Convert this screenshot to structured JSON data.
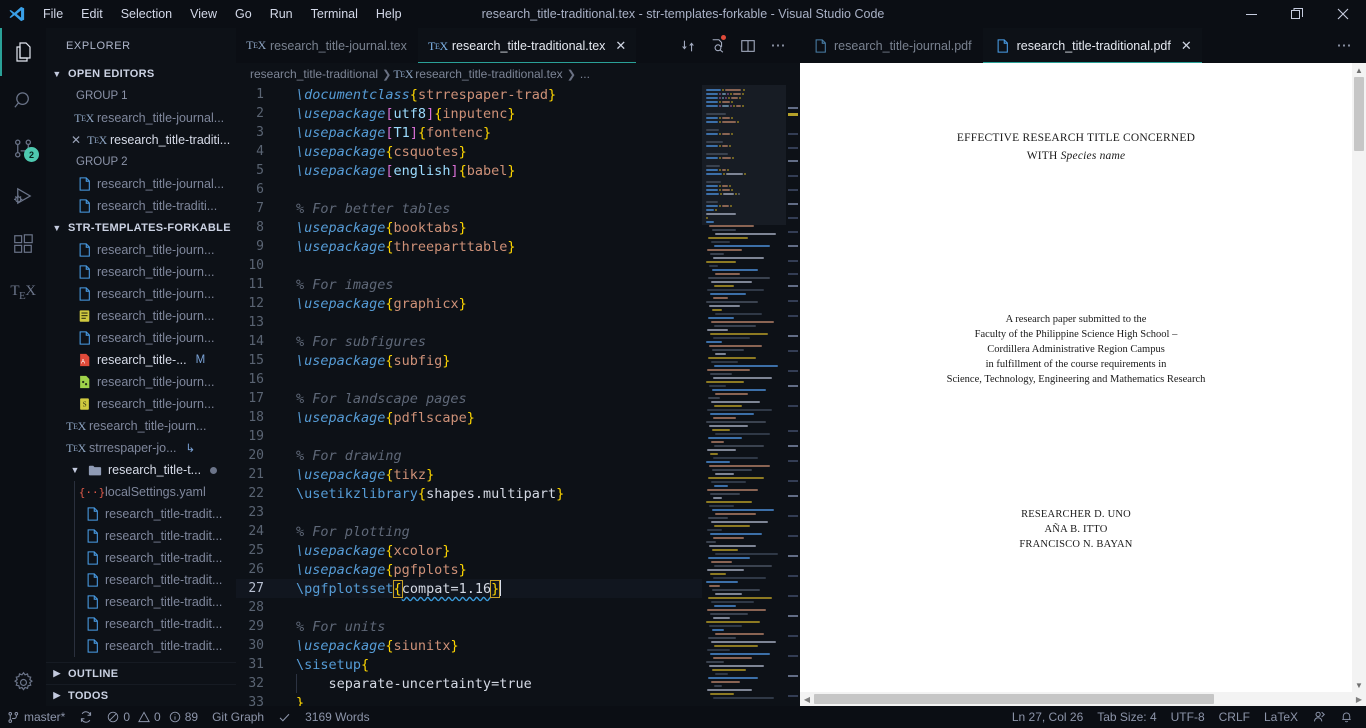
{
  "window": {
    "title": "research_title-traditional.tex - str-templates-forkable - Visual Studio Code",
    "minimize": "minimize-icon",
    "restore": "restore-icon",
    "close": "close-icon"
  },
  "menubar": {
    "items": [
      "File",
      "Edit",
      "Selection",
      "View",
      "Go",
      "Run",
      "Terminal",
      "Help"
    ]
  },
  "activitybar": {
    "items": [
      {
        "name": "explorer",
        "icon": "files-icon",
        "active": true,
        "badge": ""
      },
      {
        "name": "search",
        "icon": "search-icon",
        "active": false,
        "badge": ""
      },
      {
        "name": "source-control",
        "icon": "source-control-icon",
        "active": false,
        "badge": "2"
      },
      {
        "name": "run-and-debug",
        "icon": "run-debug-icon",
        "active": false,
        "badge": ""
      },
      {
        "name": "extensions",
        "icon": "extensions-icon",
        "active": false,
        "badge": ""
      },
      {
        "name": "latex",
        "icon": "tex-icon",
        "active": false,
        "badge": ""
      }
    ],
    "settings": {
      "name": "manage-settings",
      "icon": "gear-icon"
    }
  },
  "sidebar": {
    "title": "EXPLORER",
    "open_editors": {
      "label": "OPEN EDITORS",
      "groups": [
        {
          "label": "GROUP 1",
          "files": [
            {
              "icon": "tex-file-icon",
              "label": "research_title-journal...",
              "selected": false,
              "dirty": false,
              "close": ""
            },
            {
              "icon": "tex-file-icon",
              "label": "research_title-traditi...",
              "selected": true,
              "dirty": false,
              "close": "✕"
            }
          ]
        },
        {
          "label": "GROUP 2",
          "files": [
            {
              "icon": "pdf-blue-file-icon",
              "label": "research_title-journal...",
              "selected": false,
              "dirty": false,
              "close": ""
            },
            {
              "icon": "pdf-blue-file-icon",
              "label": "research_title-traditi...",
              "selected": false,
              "dirty": false,
              "close": ""
            }
          ]
        }
      ]
    },
    "workspace": {
      "label": "STR-TEMPLATES-FORKABLE",
      "files": [
        {
          "icon": "blue-file-icon",
          "label": "research_title-journ...",
          "suffix": ""
        },
        {
          "icon": "blue-file-icon",
          "label": "research_title-journ...",
          "suffix": ""
        },
        {
          "icon": "blue-file-icon",
          "label": "research_title-journ...",
          "suffix": ""
        },
        {
          "icon": "yellow-list-icon",
          "label": "research_title-journ...",
          "suffix": ""
        },
        {
          "icon": "blue-file-icon",
          "label": "research_title-journ...",
          "suffix": ""
        },
        {
          "icon": "pdf-red-icon",
          "label": "research_title-...",
          "suffix": "M",
          "modified": true
        },
        {
          "icon": "green-file-icon",
          "label": "research_title-journ...",
          "suffix": ""
        },
        {
          "icon": "yellow-bib-icon",
          "label": "research_title-journ...",
          "suffix": ""
        },
        {
          "icon": "tex-file-icon",
          "label": "research_title-journ...",
          "suffix": ""
        },
        {
          "icon": "tex-file-icon",
          "label": "strrespaper-jo...",
          "suffix": "↳"
        }
      ],
      "folder": {
        "icon": "folder-open-icon",
        "label": "research_title-t...",
        "dot": true,
        "children": [
          {
            "icon": "yaml-braces-icon",
            "label": "localSettings.yaml"
          },
          {
            "icon": "blue-file-icon",
            "label": "research_title-tradit..."
          },
          {
            "icon": "blue-file-icon",
            "label": "research_title-tradit..."
          },
          {
            "icon": "blue-file-icon",
            "label": "research_title-tradit..."
          },
          {
            "icon": "blue-file-icon",
            "label": "research_title-tradit..."
          },
          {
            "icon": "blue-file-icon",
            "label": "research_title-tradit..."
          },
          {
            "icon": "blue-file-icon",
            "label": "research_title-tradit..."
          },
          {
            "icon": "blue-file-icon",
            "label": "research_title-tradit..."
          }
        ]
      }
    },
    "outline": "OUTLINE",
    "todos": "TODOS"
  },
  "editor_group_1": {
    "tabs": [
      {
        "icon": "tex-file-icon",
        "label": "research_title-journal.tex",
        "active": false,
        "close": ""
      },
      {
        "icon": "tex-file-icon",
        "label": "research_title-traditional.tex",
        "active": true,
        "close": "✕"
      }
    ],
    "actions": [
      {
        "name": "build-latex-project",
        "icon": "sync-build-icon"
      },
      {
        "name": "view-latex-pdf",
        "icon": "pdf-search-icon"
      },
      {
        "name": "split-editor-right",
        "icon": "split-editor-icon"
      },
      {
        "name": "more-actions",
        "icon": "ellipsis-icon"
      }
    ],
    "breadcrumbs": [
      "research_title-traditional",
      "research_title-traditional.tex",
      "..."
    ],
    "breadcrumb_icon": "tex-file-icon",
    "active_line": 27,
    "code": [
      {
        "n": 1,
        "tokens": [
          {
            "t": "\\documentclass",
            "c": "cmd"
          },
          {
            "t": "{",
            "c": "br"
          },
          {
            "t": "strrespaper-trad",
            "c": "arg"
          },
          {
            "t": "}",
            "c": "br"
          }
        ]
      },
      {
        "n": 2,
        "tokens": [
          {
            "t": "\\usepackage",
            "c": "cmd"
          },
          {
            "t": "[",
            "c": "br2"
          },
          {
            "t": "utf8",
            "c": "opt"
          },
          {
            "t": "]",
            "c": "br2"
          },
          {
            "t": "{",
            "c": "br"
          },
          {
            "t": "inputenc",
            "c": "arg"
          },
          {
            "t": "}",
            "c": "br"
          }
        ]
      },
      {
        "n": 3,
        "tokens": [
          {
            "t": "\\usepackage",
            "c": "cmd"
          },
          {
            "t": "[",
            "c": "br2"
          },
          {
            "t": "T1",
            "c": "opt"
          },
          {
            "t": "]",
            "c": "br2"
          },
          {
            "t": "{",
            "c": "br"
          },
          {
            "t": "fontenc",
            "c": "arg"
          },
          {
            "t": "}",
            "c": "br"
          }
        ]
      },
      {
        "n": 4,
        "tokens": [
          {
            "t": "\\usepackage",
            "c": "cmd"
          },
          {
            "t": "{",
            "c": "br"
          },
          {
            "t": "csquotes",
            "c": "arg"
          },
          {
            "t": "}",
            "c": "br"
          }
        ]
      },
      {
        "n": 5,
        "tokens": [
          {
            "t": "\\usepackage",
            "c": "cmd"
          },
          {
            "t": "[",
            "c": "br2"
          },
          {
            "t": "english",
            "c": "opt"
          },
          {
            "t": "]",
            "c": "br2"
          },
          {
            "t": "{",
            "c": "br"
          },
          {
            "t": "babel",
            "c": "arg"
          },
          {
            "t": "}",
            "c": "br"
          }
        ]
      },
      {
        "n": 6,
        "tokens": []
      },
      {
        "n": 7,
        "tokens": [
          {
            "t": "% For better tables",
            "c": "cmt"
          }
        ]
      },
      {
        "n": 8,
        "tokens": [
          {
            "t": "\\usepackage",
            "c": "cmd"
          },
          {
            "t": "{",
            "c": "br"
          },
          {
            "t": "booktabs",
            "c": "arg"
          },
          {
            "t": "}",
            "c": "br"
          }
        ]
      },
      {
        "n": 9,
        "tokens": [
          {
            "t": "\\usepackage",
            "c": "cmd"
          },
          {
            "t": "{",
            "c": "br"
          },
          {
            "t": "threeparttable",
            "c": "arg"
          },
          {
            "t": "}",
            "c": "br"
          }
        ]
      },
      {
        "n": 10,
        "tokens": []
      },
      {
        "n": 11,
        "tokens": [
          {
            "t": "% For images",
            "c": "cmt"
          }
        ]
      },
      {
        "n": 12,
        "tokens": [
          {
            "t": "\\usepackage",
            "c": "cmd"
          },
          {
            "t": "{",
            "c": "br"
          },
          {
            "t": "graphicx",
            "c": "arg"
          },
          {
            "t": "}",
            "c": "br"
          }
        ]
      },
      {
        "n": 13,
        "tokens": []
      },
      {
        "n": 14,
        "tokens": [
          {
            "t": "% For subfigures",
            "c": "cmt"
          }
        ]
      },
      {
        "n": 15,
        "tokens": [
          {
            "t": "\\usepackage",
            "c": "cmd"
          },
          {
            "t": "{",
            "c": "br"
          },
          {
            "t": "subfig",
            "c": "arg"
          },
          {
            "t": "}",
            "c": "br"
          }
        ]
      },
      {
        "n": 16,
        "tokens": []
      },
      {
        "n": 17,
        "tokens": [
          {
            "t": "% For landscape pages",
            "c": "cmt"
          }
        ]
      },
      {
        "n": 18,
        "tokens": [
          {
            "t": "\\usepackage",
            "c": "cmd"
          },
          {
            "t": "{",
            "c": "br"
          },
          {
            "t": "pdflscape",
            "c": "arg"
          },
          {
            "t": "}",
            "c": "br"
          }
        ]
      },
      {
        "n": 19,
        "tokens": []
      },
      {
        "n": 20,
        "tokens": [
          {
            "t": "% For drawing",
            "c": "cmt"
          }
        ]
      },
      {
        "n": 21,
        "tokens": [
          {
            "t": "\\usepackage",
            "c": "cmd"
          },
          {
            "t": "{",
            "c": "br"
          },
          {
            "t": "tikz",
            "c": "arg"
          },
          {
            "t": "}",
            "c": "br"
          }
        ]
      },
      {
        "n": 22,
        "tokens": [
          {
            "t": "\\usetikzlibrary",
            "c": "cmd2"
          },
          {
            "t": "{",
            "c": "br"
          },
          {
            "t": "shapes.multipart",
            "c": "txt"
          },
          {
            "t": "}",
            "c": "br"
          }
        ]
      },
      {
        "n": 23,
        "tokens": []
      },
      {
        "n": 24,
        "tokens": [
          {
            "t": "% For plotting",
            "c": "cmt"
          }
        ]
      },
      {
        "n": 25,
        "tokens": [
          {
            "t": "\\usepackage",
            "c": "cmd"
          },
          {
            "t": "{",
            "c": "br"
          },
          {
            "t": "xcolor",
            "c": "arg"
          },
          {
            "t": "}",
            "c": "br"
          }
        ]
      },
      {
        "n": 26,
        "tokens": [
          {
            "t": "\\usepackage",
            "c": "cmd"
          },
          {
            "t": "{",
            "c": "br"
          },
          {
            "t": "pgfplots",
            "c": "arg"
          },
          {
            "t": "}",
            "c": "br"
          }
        ]
      },
      {
        "n": 27,
        "tokens": [
          {
            "t": "\\pgfplotsset",
            "c": "cmd2"
          },
          {
            "t": "{",
            "c": "brbox"
          },
          {
            "t": "compat=1.16",
            "c": "txtsquig"
          },
          {
            "t": "}",
            "c": "brbox"
          },
          {
            "t": "",
            "c": "cursor"
          }
        ]
      },
      {
        "n": 28,
        "tokens": []
      },
      {
        "n": 29,
        "tokens": [
          {
            "t": "% For units",
            "c": "cmt"
          }
        ]
      },
      {
        "n": 30,
        "tokens": [
          {
            "t": "\\usepackage",
            "c": "cmd"
          },
          {
            "t": "{",
            "c": "br"
          },
          {
            "t": "siunitx",
            "c": "arg"
          },
          {
            "t": "}",
            "c": "br"
          }
        ]
      },
      {
        "n": 31,
        "tokens": [
          {
            "t": "\\sisetup",
            "c": "cmd2"
          },
          {
            "t": "{",
            "c": "br"
          }
        ]
      },
      {
        "n": 32,
        "tokens": [
          {
            "t": "    separate-uncertainty=true",
            "c": "txt"
          }
        ]
      },
      {
        "n": 33,
        "tokens": [
          {
            "t": "}",
            "c": "br"
          }
        ]
      }
    ]
  },
  "editor_group_2": {
    "tabs": [
      {
        "icon": "pdf-blue-file-icon",
        "label": "research_title-journal.pdf",
        "active": false,
        "close": ""
      },
      {
        "icon": "pdf-blue-file-icon",
        "label": "research_title-traditional.pdf",
        "active": true,
        "close": "✕"
      }
    ],
    "actions": [
      {
        "name": "more-actions",
        "icon": "ellipsis-icon"
      }
    ],
    "pdf_page": {
      "title_lines": [
        "EFFECTIVE RESEARCH TITLE CONCERNED",
        "WITH "
      ],
      "title_italic": "Species name",
      "submission_lines": [
        "A research paper submitted to the",
        "Faculty of the Philippine Science High School –",
        "Cordillera Administrative Region Campus",
        "in fulfillment of the course requirements in",
        "Science, Technology, Engineering and Mathematics Research"
      ],
      "authors": [
        "RESEARCHER D. UNO",
        "AÑA B. ITTO",
        "FRANCISCO N. BAYAN"
      ]
    }
  },
  "statusbar": {
    "left": [
      {
        "name": "remote-branch",
        "icon": "source-control-icon",
        "label": "master*"
      },
      {
        "name": "sync-changes",
        "icon": "sync-icon",
        "label": ""
      },
      {
        "name": "problems",
        "icon": "error-warning-info",
        "errors": "0",
        "warnings": "0",
        "infos": "89"
      },
      {
        "name": "git-graph",
        "icon": "",
        "label": "Git Graph"
      },
      {
        "name": "latex-build-status",
        "icon": "check-icon",
        "label": ""
      },
      {
        "name": "word-count",
        "icon": "",
        "label": "3169 Words"
      }
    ],
    "right": [
      {
        "name": "editor-position",
        "label": "Ln 27, Col 26"
      },
      {
        "name": "indentation",
        "label": "Tab Size: 4"
      },
      {
        "name": "encoding",
        "label": "UTF-8"
      },
      {
        "name": "eol",
        "label": "CRLF"
      },
      {
        "name": "language-mode",
        "label": "LaTeX"
      },
      {
        "name": "live-share",
        "icon": "live-share-icon",
        "label": ""
      },
      {
        "name": "notifications",
        "icon": "bell-icon",
        "label": ""
      }
    ]
  },
  "colors": {
    "accent": "#2aa198",
    "badge": "#4ec9b0",
    "editor_bg": "#0d1117",
    "chrome_bg": "#0b0e14",
    "comment": "#5f6878",
    "command": "#569cd6",
    "argument": "#ce9178",
    "brace": "#ffd700",
    "option": "#9cdcfe"
  }
}
